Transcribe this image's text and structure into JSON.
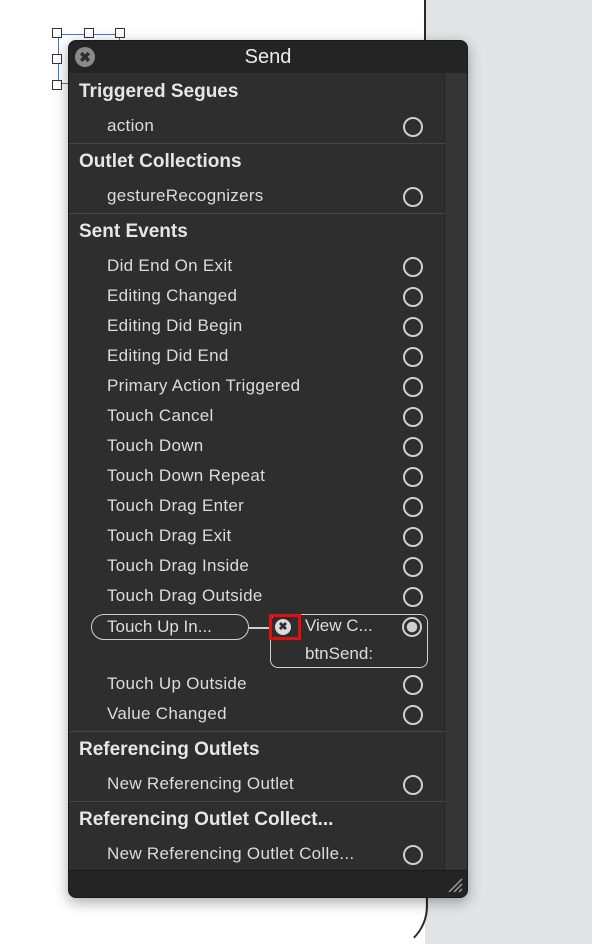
{
  "panel": {
    "title": "Send",
    "close_glyph": "✖"
  },
  "sections": {
    "triggered_segues": {
      "heading": "Triggered Segues",
      "items": [
        "action"
      ]
    },
    "outlet_collections": {
      "heading": "Outlet Collections",
      "items": [
        "gestureRecognizers"
      ]
    },
    "sent_events": {
      "heading": "Sent Events",
      "items": [
        "Did End On Exit",
        "Editing Changed",
        "Editing Did Begin",
        "Editing Did End",
        "Primary Action Triggered",
        "Touch Cancel",
        "Touch Down",
        "Touch Down Repeat",
        "Touch Drag Enter",
        "Touch Drag Exit",
        "Touch Drag Inside",
        "Touch Drag Outside"
      ],
      "connected": {
        "event_label": "Touch Up In...",
        "target_line1": "View C...",
        "target_line2": "btnSend:",
        "remove_glyph": "✖"
      },
      "items_after": [
        "Touch Up Outside",
        "Value Changed"
      ]
    },
    "referencing_outlets": {
      "heading": "Referencing Outlets",
      "items": [
        "New Referencing Outlet"
      ]
    },
    "referencing_outlet_collections": {
      "heading": "Referencing Outlet Collect...",
      "items": [
        "New Referencing Outlet Colle..."
      ]
    }
  },
  "colors": {
    "panel_bg": "#2e2e2e",
    "highlight_red": "#e01010",
    "canvas_bg": "#e3e4e8"
  }
}
